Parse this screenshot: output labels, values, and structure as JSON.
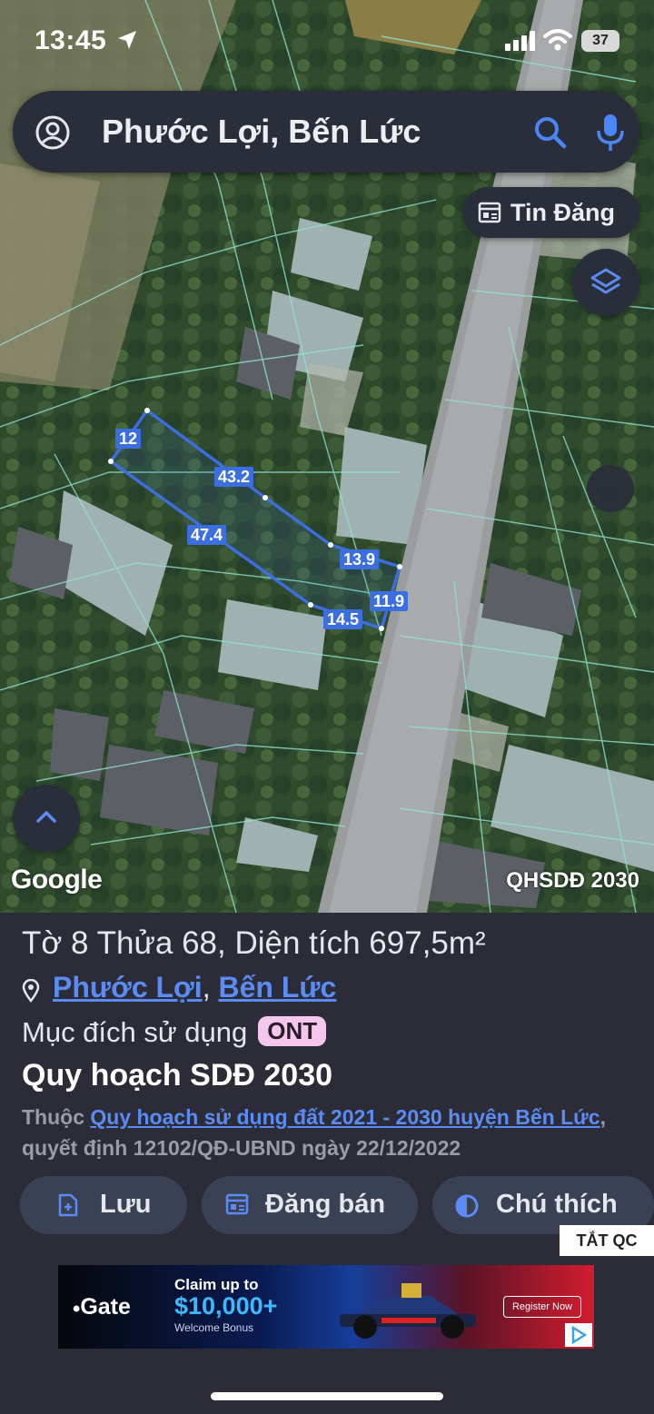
{
  "status_bar": {
    "time": "13:45",
    "battery": "37"
  },
  "search": {
    "query": "Phước Lợi, Bến Lức"
  },
  "map": {
    "tin_dang_label": "Tin Đăng",
    "google_label": "Google",
    "layer_label": "QHSDĐ 2030",
    "parcel_dimensions": [
      "12",
      "43.2",
      "47.4",
      "13.9",
      "11.9",
      "14.5"
    ],
    "parcel_color": "#3b6fe0"
  },
  "parcel": {
    "title": "Tờ 8 Thửa 68, Diện tích 697,5m²",
    "commune_link": "Phước Lợi",
    "separator": ",",
    "district_link": "Bến Lức",
    "purpose_label": "Mục đích sử dụng",
    "purpose_code": "ONT",
    "plan_title": "Quy hoạch SDĐ 2030",
    "plan_prefix": "Thuộc",
    "plan_link": "Quy hoạch sử dụng đất 2021 - 2030 huyện Bến Lức",
    "plan_suffix": ", quyết định 12102/QĐ-UBND ngày 22/12/2022"
  },
  "actions": {
    "save_label": "Lưu",
    "sell_label": "Đăng bán",
    "legend_label": "Chú thích"
  },
  "ad": {
    "hide_label": "TẮT QC",
    "brand": "Gate",
    "claim": "Claim up to",
    "amount": "$10,000+",
    "bonus": "Welcome Bonus",
    "cta": "Register Now"
  },
  "colors": {
    "accent": "#5b8cf5",
    "panel_bg": "#2b2c37",
    "badge_bg": "#f6c7ee"
  }
}
